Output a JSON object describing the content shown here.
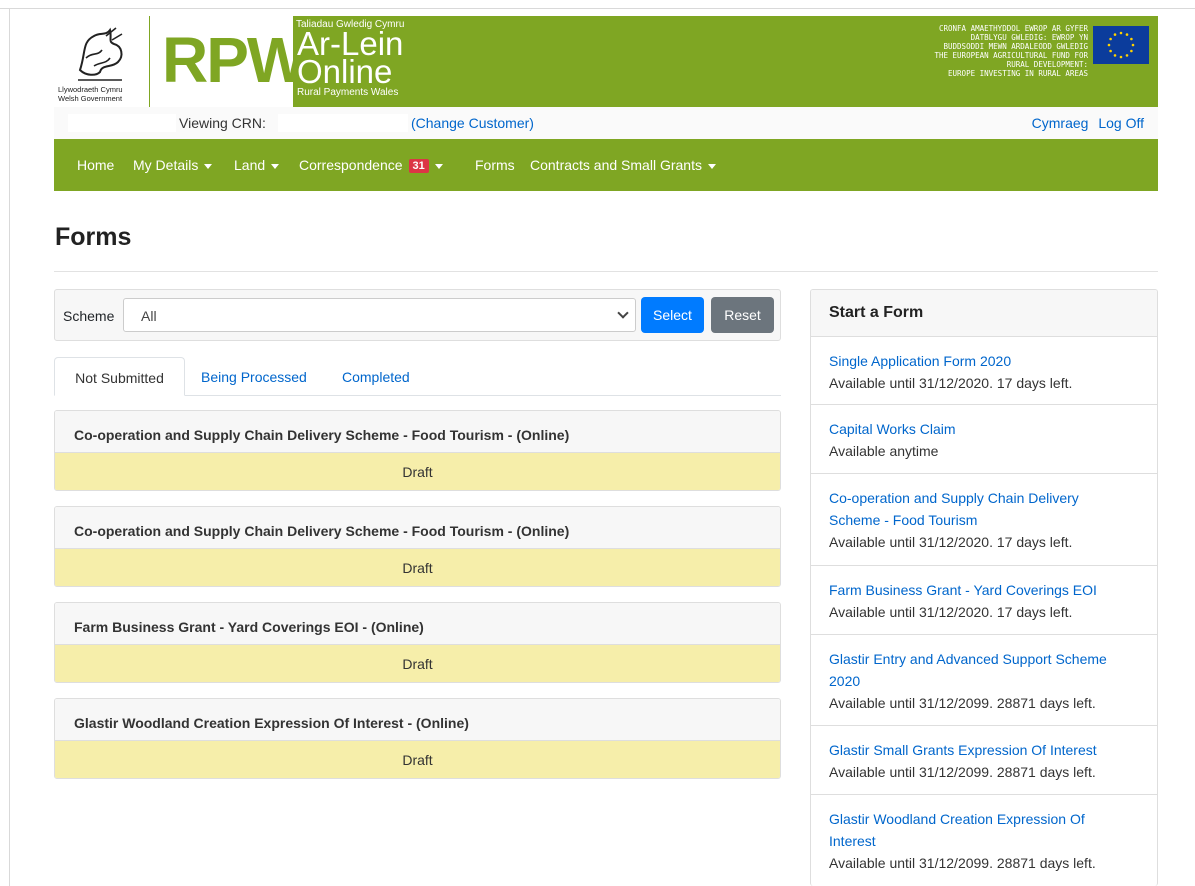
{
  "banner": {
    "wg_name_cy": "Llywodraeth Cymru",
    "wg_name_en": "Welsh Government",
    "rpw": "RPW",
    "arlein_top": "Taliadau Gwledig Cymru",
    "arlein_line1": "Ar-Lein",
    "arlein_line2": "Online",
    "arlein_bottom": "Rural Payments Wales",
    "eu_line1": "CRONFA AMAETHYDDOL EWROP AR GYFER",
    "eu_line2": "DATBLYGU GWLEDIG: EWROP YN",
    "eu_line3": "BUDDSODDI MEWN ARDALEODD GWLEDIG",
    "eu_line4": "THE EUROPEAN AGRICULTURAL FUND FOR",
    "eu_line5": "RURAL DEVELOPMENT:",
    "eu_line6": "EUROPE INVESTING IN RURAL AREAS"
  },
  "customer_bar": {
    "viewing_label": "Viewing CRN:",
    "change_link": "(Change Customer)",
    "language_link": "Cymraeg",
    "logoff_link": "Log Off"
  },
  "nav": {
    "home": "Home",
    "my_details": "My Details",
    "land": "Land",
    "correspondence": "Correspondence",
    "correspondence_count": "31",
    "forms": "Forms",
    "contracts": "Contracts and Small Grants"
  },
  "page": {
    "title": "Forms"
  },
  "filter": {
    "label": "Scheme",
    "selected": "All",
    "select_button": "Select",
    "reset_button": "Reset"
  },
  "tabs": [
    "Not Submitted",
    "Being Processed",
    "Completed"
  ],
  "forms": [
    {
      "name": "Co-operation and Supply Chain Delivery Scheme - Food Tourism - (Online)",
      "status": "Draft"
    },
    {
      "name": "Co-operation and Supply Chain Delivery Scheme - Food Tourism - (Online)",
      "status": "Draft"
    },
    {
      "name": "Farm Business Grant - Yard Coverings EOI - (Online)",
      "status": "Draft"
    },
    {
      "name": "Glastir Woodland Creation Expression Of Interest - (Online)",
      "status": "Draft"
    }
  ],
  "start_form": {
    "heading": "Start a Form",
    "items": [
      {
        "link_lines": [
          "Single Application Form 2020"
        ],
        "availability": "Available until 31/12/2020. 17 days left."
      },
      {
        "link_lines": [
          "Capital Works Claim"
        ],
        "availability": "Available anytime"
      },
      {
        "link_lines": [
          "Co-operation and Supply Chain Delivery",
          "Scheme - Food Tourism"
        ],
        "availability": "Available until 31/12/2020. 17 days left."
      },
      {
        "link_lines": [
          "Farm Business Grant - Yard Coverings EOI"
        ],
        "availability": "Available until 31/12/2020. 17 days left."
      },
      {
        "link_lines": [
          "Glastir Entry and Advanced Support Scheme",
          "2020"
        ],
        "availability": "Available until 31/12/2099. 28871 days left."
      },
      {
        "link_lines": [
          "Glastir Small Grants Expression Of Interest"
        ],
        "availability": "Available until 31/12/2099. 28871 days left."
      },
      {
        "link_lines": [
          "Glastir Woodland Creation Expression Of",
          "Interest"
        ],
        "availability": "Available until 31/12/2099. 28871 days left."
      }
    ]
  },
  "colors": {
    "brand_green": "#7fa623",
    "link_blue": "#0066cc",
    "primary_button": "#007bff",
    "secondary_button": "#6c757d",
    "badge_red": "#dc3545",
    "draft_yellow": "#f6eeaa"
  }
}
